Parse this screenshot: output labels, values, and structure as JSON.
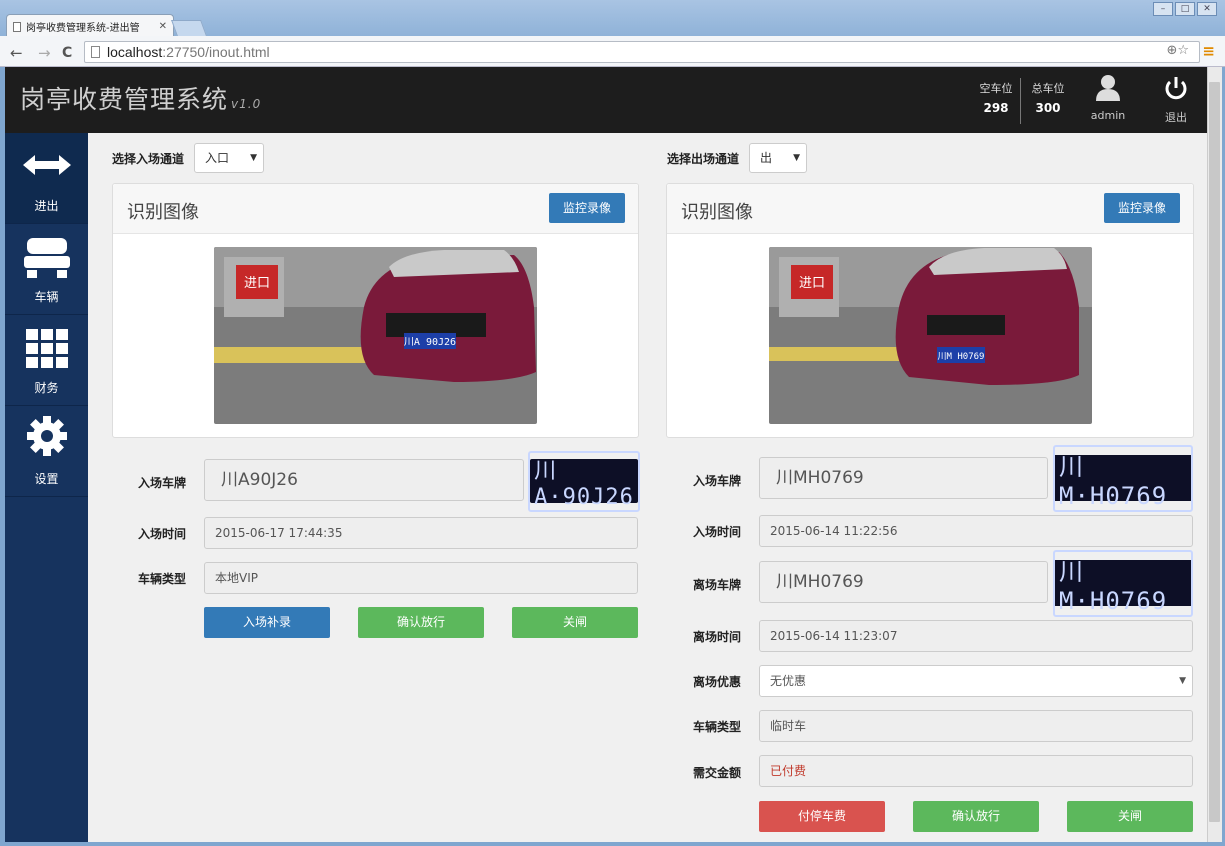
{
  "browser": {
    "tab_title": "岗亭收费管理系统-进出管",
    "url_host": "localhost",
    "url_port_path": ":27750/inout.html"
  },
  "app": {
    "title": "岗亭收费管理系统",
    "version": "v1.0",
    "stats": [
      {
        "label": "空车位",
        "value": "298"
      },
      {
        "label": "总车位",
        "value": "300"
      }
    ],
    "user": "admin",
    "logout": "退出"
  },
  "sidebar": {
    "items": [
      {
        "label": "进出",
        "icon": "arrows-icon",
        "active": true
      },
      {
        "label": "车辆",
        "icon": "vehicle-icon",
        "active": false
      },
      {
        "label": "财务",
        "icon": "grid-icon",
        "active": false
      },
      {
        "label": "设置",
        "icon": "gear-icon",
        "active": false
      }
    ]
  },
  "entry": {
    "channel_label": "选择入场通道",
    "channel_value": "入口",
    "panel_title": "识别图像",
    "monitor_button": "监控录像",
    "plate_label": "入场车牌",
    "plate_value": "川A90J26",
    "plate_image_text": "川A·90J26",
    "time_label": "入场时间",
    "time_value": "2015-06-17 17:44:35",
    "type_label": "车辆类型",
    "type_value": "本地VIP",
    "btn_supplement": "入场补录",
    "btn_confirm": "确认放行",
    "btn_close": "关闸",
    "photo_sign": "进口",
    "photo_plate": "川A 90J26"
  },
  "exit": {
    "channel_label": "选择出场通道",
    "channel_value": "出",
    "panel_title": "识别图像",
    "monitor_button": "监控录像",
    "entry_plate_label": "入场车牌",
    "entry_plate_value": "川MH0769",
    "plate_image_text": "川M·H0769",
    "entry_time_label": "入场时间",
    "entry_time_value": "2015-06-14 11:22:56",
    "exit_plate_label": "离场车牌",
    "exit_plate_value": "川MH0769",
    "exit_time_label": "离场时间",
    "exit_time_value": "2015-06-14 11:23:07",
    "discount_label": "离场优惠",
    "discount_value": "无优惠",
    "type_label": "车辆类型",
    "type_value": "临时车",
    "amount_label": "需交金额",
    "amount_value": "已付费",
    "btn_pay": "付停车费",
    "btn_confirm": "确认放行",
    "btn_close": "关闸",
    "photo_sign": "进口",
    "photo_plate": "川M H0769"
  },
  "colors": {
    "header_bg": "#1d1d1d",
    "sidebar_bg": "#16335e",
    "primary": "#337ab7",
    "success": "#5cb85c",
    "danger": "#d9534f",
    "paid_text": "#c0392b"
  }
}
